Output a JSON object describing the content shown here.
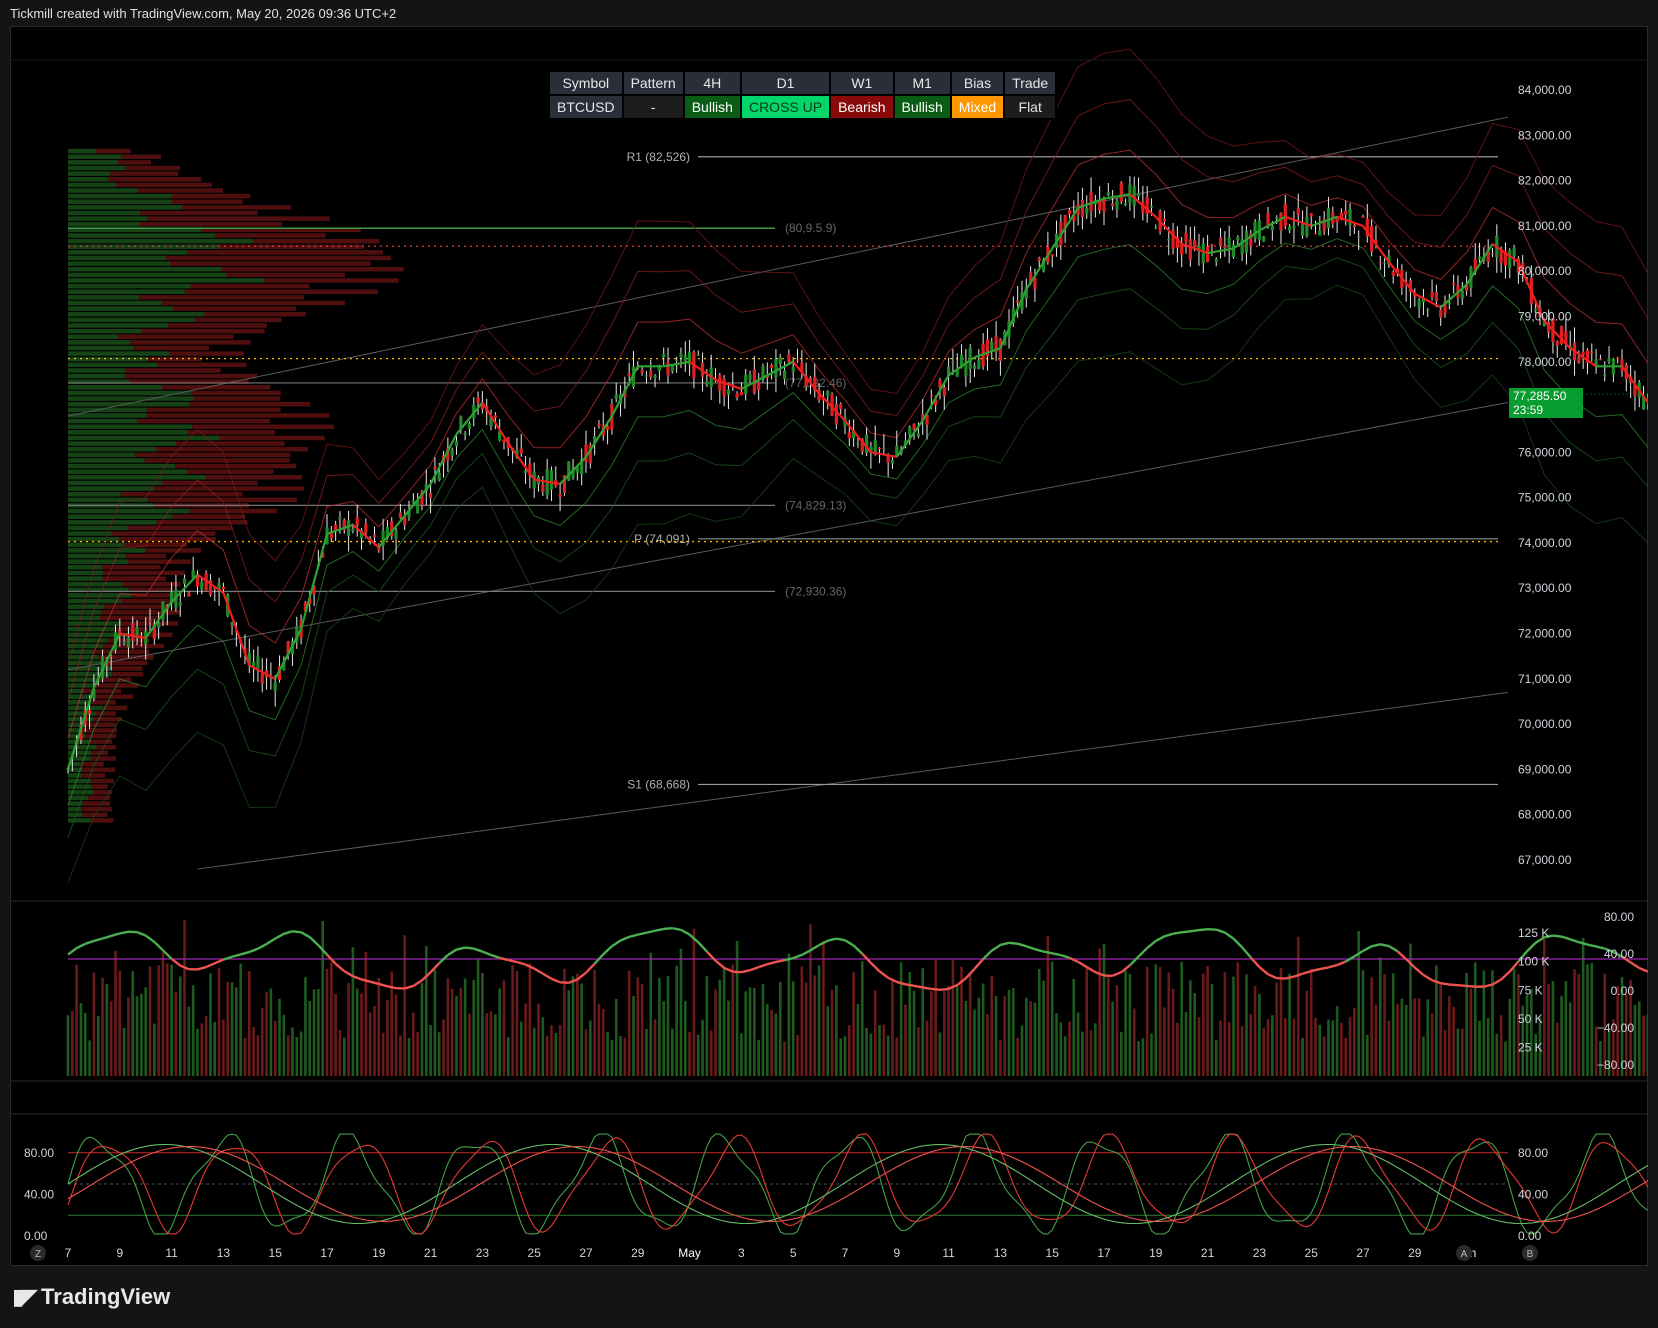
{
  "header": {
    "credit": "Tickmill created with TradingView.com, May 20, 2026 09:36 UTC+2"
  },
  "footer": {
    "brand": "TradingView"
  },
  "colors": {
    "up": "#22ab38",
    "down": "#ea2c2c",
    "bg": "#000000",
    "grid": "#1e1e1e"
  },
  "table": {
    "headers": [
      "Symbol",
      "Pattern",
      "4H",
      "D1",
      "W1",
      "M1",
      "Bias",
      "Trade"
    ],
    "values": [
      {
        "text": "BTCUSD",
        "bg": "#2a2e39",
        "fg": "#e6e6e6"
      },
      {
        "text": "-",
        "bg": "#1c1c1c",
        "fg": "#e6e6e6"
      },
      {
        "text": "Bullish",
        "bg": "#0b5c14",
        "fg": "#ffffff"
      },
      {
        "text": "CROSS UP",
        "bg": "#00d66a",
        "fg": "#0b3d1a"
      },
      {
        "text": "Bearish",
        "bg": "#8a0a0a",
        "fg": "#ffffff"
      },
      {
        "text": "Bullish",
        "bg": "#0b5c14",
        "fg": "#ffffff"
      },
      {
        "text": "Mixed",
        "bg": "#ff9800",
        "fg": "#ffffff"
      },
      {
        "text": "Flat",
        "bg": "#1c1c1c",
        "fg": "#e6e6e6"
      }
    ]
  },
  "last_price": {
    "price": "77,285.50",
    "countdown": "23:59"
  },
  "chart_data": [
    {
      "type": "line",
      "panel": "price",
      "symbol": "BTCUSD",
      "y_ticks": [
        "84,000.00",
        "83,000.00",
        "82,000.00",
        "81,000.00",
        "80,000.00",
        "79,000.00",
        "78,000.00",
        "77,000.00",
        "76,000.00",
        "75,000.00",
        "74,000.00",
        "73,000.00",
        "72,000.00",
        "71,000.00",
        "70,000.00",
        "69,000.00",
        "68,000.00",
        "67,000.00"
      ],
      "ylim": [
        66500,
        84700
      ],
      "x_ticks": [
        "7",
        "9",
        "11",
        "13",
        "15",
        "17",
        "19",
        "21",
        "23",
        "25",
        "27",
        "29",
        "May",
        "3",
        "5",
        "7",
        "9",
        "11",
        "13",
        "15",
        "17",
        "19",
        "21",
        "23",
        "25",
        "27",
        "29",
        "Jun"
      ],
      "x_start": "2026-04-07",
      "series": [
        {
          "values": [
            [
              0,
              69000
            ],
            [
              1,
              70800
            ],
            [
              2,
              72000
            ],
            [
              3,
              71900
            ],
            [
              4,
              72700
            ],
            [
              5,
              73300
            ],
            [
              6,
              72900
            ],
            [
              7,
              71300
            ],
            [
              8,
              71000
            ],
            [
              9,
              72100
            ],
            [
              10,
              74200
            ],
            [
              11,
              74400
            ],
            [
              12,
              73900
            ],
            [
              13,
              74600
            ],
            [
              14,
              75300
            ],
            [
              15,
              76400
            ],
            [
              16,
              77100
            ],
            [
              17,
              76200
            ],
            [
              18,
              75400
            ],
            [
              19,
              75300
            ],
            [
              20,
              75900
            ],
            [
              21,
              76800
            ],
            [
              22,
              77900
            ],
            [
              23,
              77900
            ],
            [
              24,
              78000
            ],
            [
              25,
              77600
            ],
            [
              26,
              77400
            ],
            [
              27,
              77700
            ],
            [
              28,
              78000
            ],
            [
              29,
              77300
            ],
            [
              30,
              76700
            ],
            [
              31,
              76000
            ],
            [
              32,
              75900
            ],
            [
              33,
              76700
            ],
            [
              34,
              77700
            ],
            [
              35,
              78100
            ],
            [
              36,
              78300
            ],
            [
              37,
              79600
            ],
            [
              38,
              80500
            ],
            [
              39,
              81400
            ],
            [
              40,
              81600
            ],
            [
              41,
              81700
            ],
            [
              42,
              81200
            ],
            [
              43,
              80600
            ],
            [
              44,
              80400
            ],
            [
              45,
              80500
            ],
            [
              46,
              80900
            ],
            [
              47,
              81200
            ],
            [
              48,
              81000
            ],
            [
              49,
              81200
            ],
            [
              50,
              81000
            ],
            [
              51,
              80200
            ],
            [
              52,
              79500
            ],
            [
              53,
              79200
            ],
            [
              54,
              79700
            ],
            [
              55,
              80600
            ],
            [
              56,
              80200
            ],
            [
              57,
              78900
            ],
            [
              58,
              78300
            ],
            [
              59,
              77900
            ],
            [
              60,
              77900
            ],
            [
              61,
              77100
            ],
            [
              62,
              76800
            ],
            [
              63,
              76900
            ],
            [
              64,
              77000
            ],
            [
              65,
              77280
            ]
          ]
        }
      ],
      "levels": [
        {
          "label": "R1 (82,526)",
          "value": 82526
        },
        {
          "label": "P (74,091)",
          "value": 74091
        },
        {
          "label": "S1 (68,668)",
          "value": 68668
        },
        {
          "label": "(77,532.46)",
          "value": 77532
        },
        {
          "label": "(74,829.13)",
          "value": 74829
        },
        {
          "label": "(72,930.36)",
          "value": 72930
        },
        {
          "label": "(80,9.5.9)",
          "value": 80950
        }
      ],
      "dotted_levels": [
        {
          "value": 80550,
          "color": "#e53935"
        },
        {
          "value": 78070,
          "color": "#ffb300"
        },
        {
          "value": 74030,
          "color": "#ffb300"
        }
      ]
    },
    {
      "type": "bar",
      "panel": "volume",
      "y_ticks": [
        "125 K",
        "100 K",
        "75 K",
        "50 K",
        "25 K"
      ],
      "y_ticks_right": [
        "80.00",
        "40.00",
        "0.00",
        "−40.00",
        "−80.00"
      ]
    },
    {
      "type": "line",
      "panel": "stochastic",
      "y_ticks_left": [
        "80.00",
        "40.00",
        "0.00"
      ],
      "y_ticks_right": [
        "80.00",
        "40.00",
        "0.00"
      ]
    }
  ],
  "bottom_buttons": {
    "left": "Z",
    "auto": "A",
    "base": "B"
  }
}
